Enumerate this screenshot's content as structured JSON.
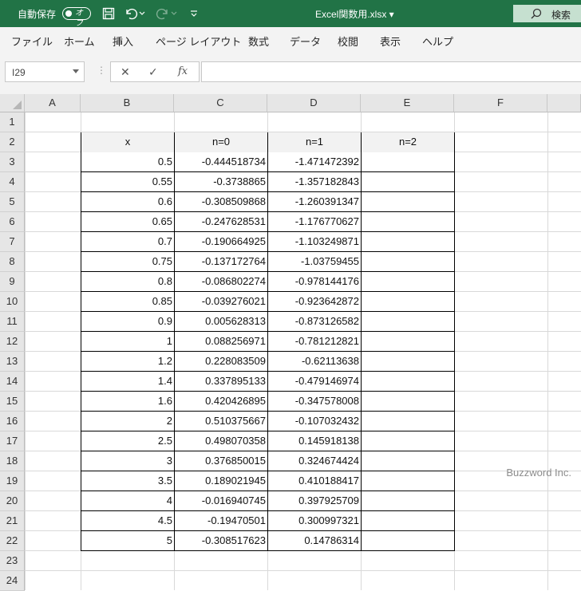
{
  "titlebar": {
    "autosave_label": "自動保存",
    "autosave_state": "オフ",
    "doc_title": "Excel関数用.xlsx ▾",
    "search_label": "検索",
    "accent": "#217346"
  },
  "ribbon": {
    "tabs": [
      "ファイル",
      "ホーム",
      "挿入",
      "ページ レイアウト",
      "数式",
      "データ",
      "校閲",
      "表示",
      "ヘルプ"
    ]
  },
  "formula_bar": {
    "name_box": "I29",
    "formula": "",
    "icons": [
      "cancel-icon",
      "enter-icon",
      "function-icon"
    ]
  },
  "sheet": {
    "columns": [
      "A",
      "B",
      "C",
      "D",
      "E",
      "F"
    ],
    "rows": [
      "1",
      "2",
      "3",
      "4",
      "5",
      "6",
      "7",
      "8",
      "9",
      "10",
      "11",
      "12",
      "13",
      "14",
      "15",
      "16",
      "17",
      "18",
      "19",
      "20",
      "21",
      "22",
      "23",
      "24"
    ],
    "table_headers": [
      "x",
      "n=0",
      "n=1",
      "n=2"
    ],
    "table_rows": [
      [
        "0.5",
        "-0.444518734",
        "-1.471472392",
        ""
      ],
      [
        "0.55",
        "-0.3738865",
        "-1.357182843",
        ""
      ],
      [
        "0.6",
        "-0.308509868",
        "-1.260391347",
        ""
      ],
      [
        "0.65",
        "-0.247628531",
        "-1.176770627",
        ""
      ],
      [
        "0.7",
        "-0.190664925",
        "-1.103249871",
        ""
      ],
      [
        "0.75",
        "-0.137172764",
        "-1.03759455",
        ""
      ],
      [
        "0.8",
        "-0.086802274",
        "-0.978144176",
        ""
      ],
      [
        "0.85",
        "-0.039276021",
        "-0.923642872",
        ""
      ],
      [
        "0.9",
        "0.005628313",
        "-0.873126582",
        ""
      ],
      [
        "1",
        "0.088256971",
        "-0.781212821",
        ""
      ],
      [
        "1.2",
        "0.228083509",
        "-0.62113638",
        ""
      ],
      [
        "1.4",
        "0.337895133",
        "-0.479146974",
        ""
      ],
      [
        "1.6",
        "0.420426895",
        "-0.347578008",
        ""
      ],
      [
        "2",
        "0.510375667",
        "-0.107032432",
        ""
      ],
      [
        "2.5",
        "0.498070358",
        "0.145918138",
        ""
      ],
      [
        "3",
        "0.376850015",
        "0.324674424",
        ""
      ],
      [
        "3.5",
        "0.189021945",
        "0.410188417",
        ""
      ],
      [
        "4",
        "-0.016940745",
        "0.397925709",
        ""
      ],
      [
        "4.5",
        "-0.19470501",
        "0.300997321",
        ""
      ],
      [
        "5",
        "-0.308517623",
        "0.14786314",
        ""
      ]
    ]
  },
  "watermark": "Buzzword Inc."
}
